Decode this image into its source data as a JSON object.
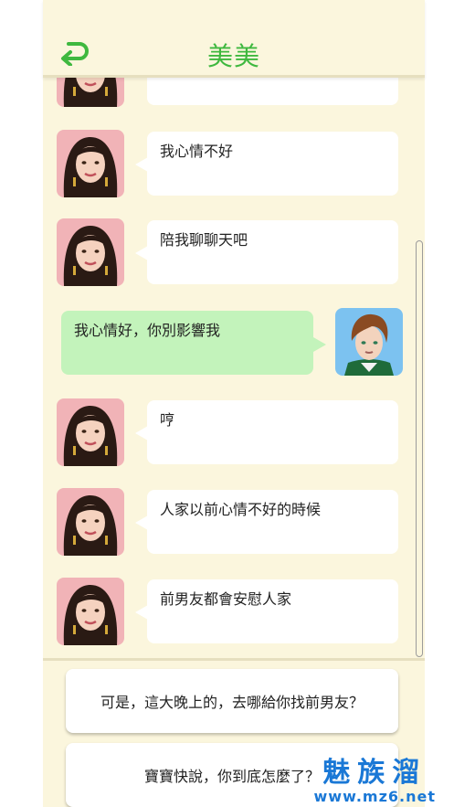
{
  "header": {
    "title": "美美",
    "back_icon": "back-arrow-icon"
  },
  "colors": {
    "accent": "#3fb83f",
    "background": "#fbf6dd",
    "bubble_self": "#c3f3bb",
    "bubble_other": "#ffffff"
  },
  "messages": [
    {
      "sender": "other",
      "text": ""
    },
    {
      "sender": "other",
      "text": "我心情不好"
    },
    {
      "sender": "other",
      "text": "陪我聊聊天吧"
    },
    {
      "sender": "self",
      "text": "我心情好，你別影響我"
    },
    {
      "sender": "other",
      "text": "哼"
    },
    {
      "sender": "other",
      "text": "人家以前心情不好的時候"
    },
    {
      "sender": "other",
      "text": "前男友都會安慰人家"
    }
  ],
  "choices": [
    {
      "label": "可是，這大晚上的，去哪給你找前男友？"
    },
    {
      "label": "寶寶快說，你到底怎麼了？"
    }
  ],
  "watermark": {
    "main": "魅族溜",
    "sub": "www.mz6.net"
  }
}
